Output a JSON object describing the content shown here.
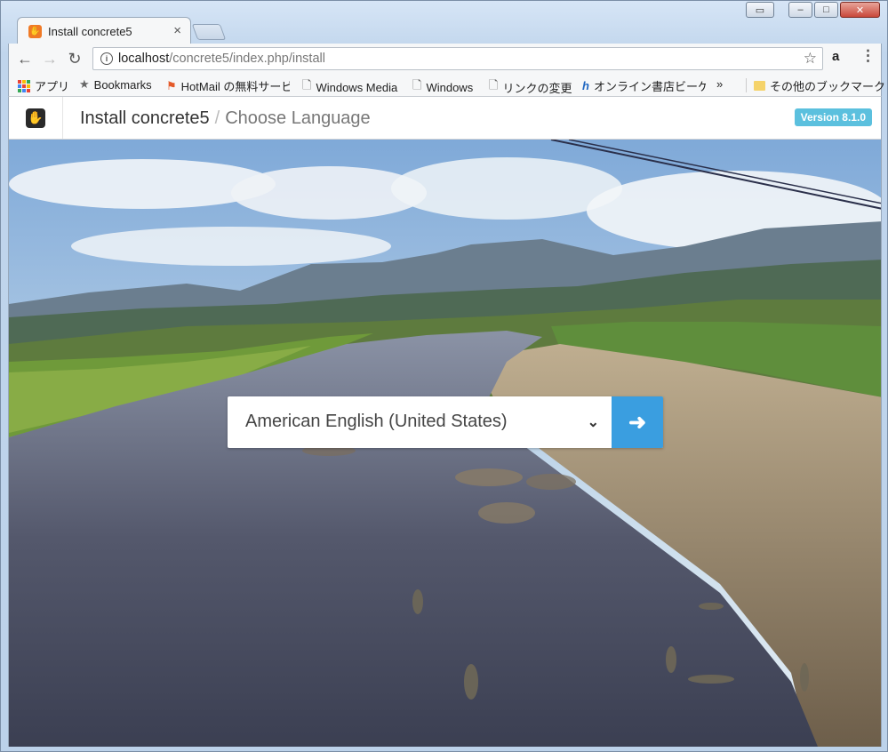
{
  "browser": {
    "tab_title": "Install concrete5",
    "tab_close": "×",
    "url_host": "localhost",
    "url_path": "/concrete5/index.php/install"
  },
  "window_controls": {
    "minimize": "–",
    "maximize": "□",
    "close": "✕"
  },
  "bookmarks": [
    {
      "label": "アプリ",
      "icon": "apps-icon"
    },
    {
      "label": "Bookmarks",
      "icon": "star-icon"
    },
    {
      "label": "HotMail の無料サービ",
      "icon": "windows-flag-icon"
    },
    {
      "label": "Windows Media",
      "icon": "page-icon"
    },
    {
      "label": "Windows",
      "icon": "page-icon"
    },
    {
      "label": "リンクの変更",
      "icon": "page-icon"
    },
    {
      "label": "オンライン書店ビーケ",
      "icon": "h-icon"
    },
    {
      "label": "»",
      "icon": "overflow-icon"
    },
    {
      "label": "その他のブックマーク",
      "icon": "folder-icon"
    }
  ],
  "header": {
    "title": "Install concrete5",
    "separator": "/",
    "step": "Choose Language",
    "version": "Version 8.1.0"
  },
  "language": {
    "selected": "American English (United States)"
  },
  "colors": {
    "accent": "#3a9ee0",
    "version_badge": "#5bc0de"
  }
}
